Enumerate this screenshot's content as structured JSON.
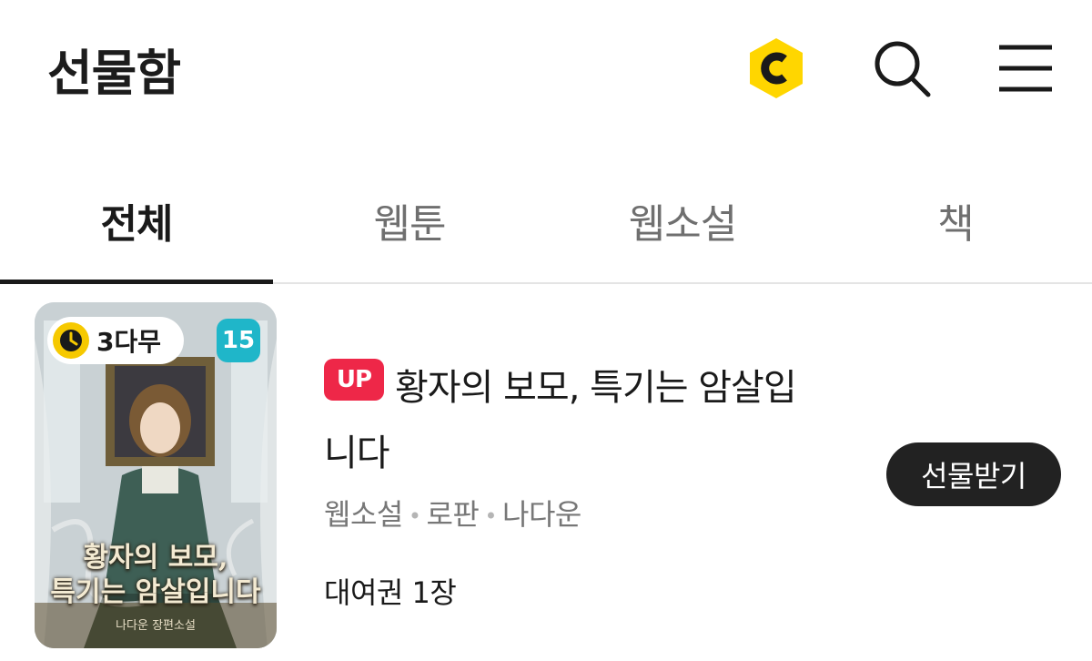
{
  "header": {
    "title": "선물함",
    "coin_icon": "cash-coin-icon",
    "coin_letter": "C",
    "coin_color": "#FFD600",
    "search_icon": "search-icon",
    "menu_icon": "hamburger-menu-icon"
  },
  "tabs": [
    {
      "label": "전체",
      "active": true
    },
    {
      "label": "웹툰",
      "active": false
    },
    {
      "label": "웹소설",
      "active": false
    },
    {
      "label": "책",
      "active": false
    }
  ],
  "items": [
    {
      "badge": "UP",
      "badge_color": "#EE2748",
      "title_line1": "황자의 보모, 특기는 암살입",
      "title_line2": "니다",
      "meta": [
        "웹소설",
        "로판",
        "나다운"
      ],
      "ticket": "대여권 1장",
      "action_label": "선물받기",
      "cover": {
        "wait_label": "3다무",
        "wait_icon": "clock-icon",
        "age_rating": "15",
        "age_color": "#1FB6C9",
        "title_line1": "황자의 보모,",
        "title_line2": "특기는 암살입니다",
        "author": "나다운 장편소설"
      }
    }
  ]
}
